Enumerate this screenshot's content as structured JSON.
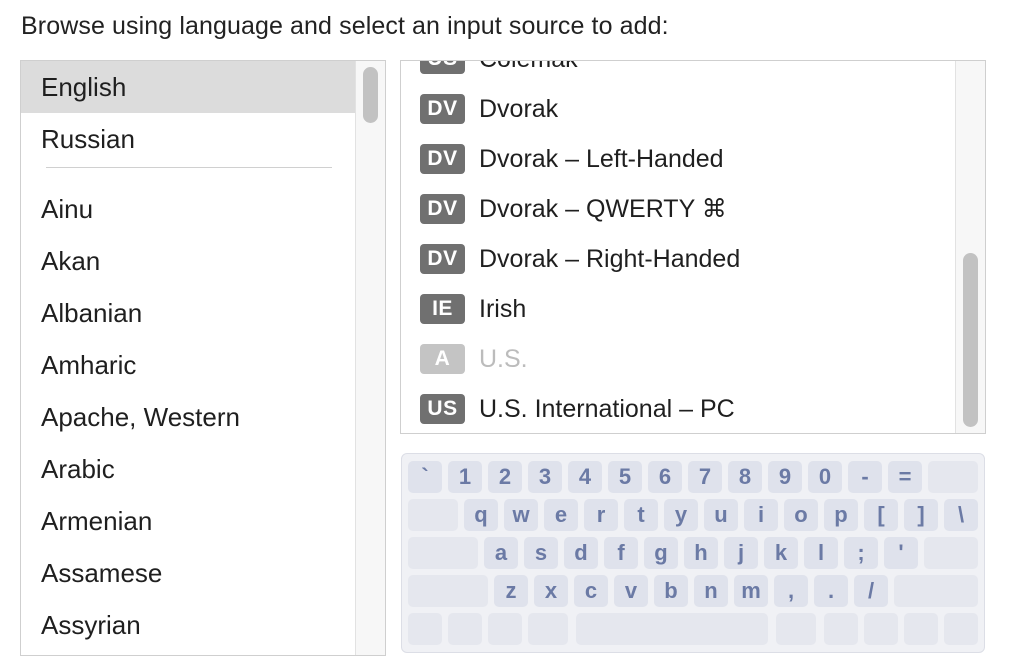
{
  "header": {
    "title": "Browse using language and select an input source to add:"
  },
  "languages": {
    "preferred": [
      "English",
      "Russian"
    ],
    "others": [
      "Ainu",
      "Akan",
      "Albanian",
      "Amharic",
      "Apache, Western",
      "Arabic",
      "Armenian",
      "Assamese",
      "Assyrian"
    ],
    "selected": "English"
  },
  "sources": {
    "items": [
      {
        "badge": "US",
        "label": "Colemak",
        "disabled": false
      },
      {
        "badge": "DV",
        "label": "Dvorak",
        "disabled": false
      },
      {
        "badge": "DV",
        "label": "Dvorak – Left-Handed",
        "disabled": false
      },
      {
        "badge": "DV",
        "label": "Dvorak – QWERTY ⌘",
        "disabled": false
      },
      {
        "badge": "DV",
        "label": "Dvorak – Right-Handed",
        "disabled": false
      },
      {
        "badge": "IE",
        "label": "Irish",
        "disabled": false
      },
      {
        "badge": "A",
        "label": "U.S.",
        "disabled": true
      },
      {
        "badge": "US",
        "label": "U.S. International – PC",
        "disabled": false
      }
    ]
  },
  "keyboard": {
    "rows": [
      [
        "`",
        "1",
        "2",
        "3",
        "4",
        "5",
        "6",
        "7",
        "8",
        "9",
        "0",
        "-",
        "="
      ],
      [
        "q",
        "w",
        "e",
        "r",
        "t",
        "y",
        "u",
        "i",
        "o",
        "p",
        "[",
        "]",
        "\\"
      ],
      [
        "a",
        "s",
        "d",
        "f",
        "g",
        "h",
        "j",
        "k",
        "l",
        ";",
        "'"
      ],
      [
        "z",
        "x",
        "c",
        "v",
        "b",
        "n",
        "m",
        ",",
        ".",
        "/"
      ]
    ]
  }
}
